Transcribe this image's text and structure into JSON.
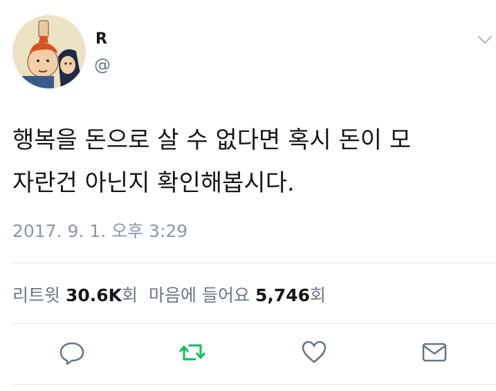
{
  "user": {
    "name": "R",
    "handle": "@"
  },
  "tweet": {
    "line1": "행복을 돈으로 살 수 없다면 혹시 돈이 모",
    "line2": "자란건 아닌지 확인해봅시다.",
    "timestamp": "2017. 9. 1. 오후 3:29"
  },
  "stats": {
    "retweets_label": "리트윗",
    "retweets_count": "30.6K",
    "retweets_unit": "회",
    "likes_label": "마음에 들어요",
    "likes_count": "5,746",
    "likes_unit": "회"
  },
  "icons": {
    "reply": "reply-icon",
    "retweet": "retweet-icon",
    "like": "heart-icon",
    "dm": "envelope-icon",
    "menu": "chevron-down-icon"
  },
  "colors": {
    "retweet_active": "#17bf63",
    "icon_gray": "#657786",
    "secondary_text": "#8899a6"
  }
}
